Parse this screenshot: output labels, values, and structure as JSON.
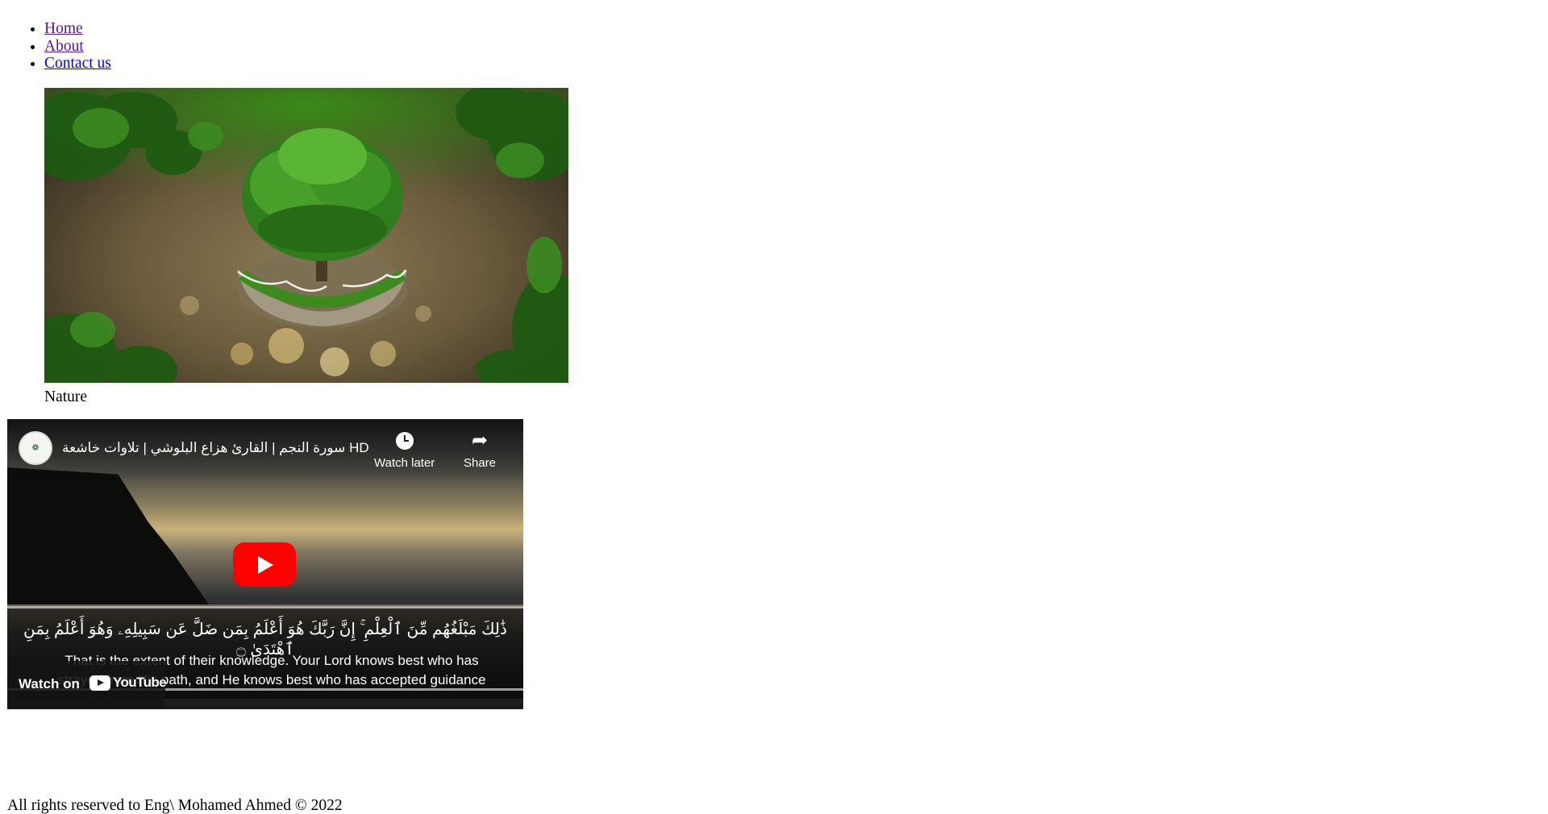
{
  "nav": {
    "items": [
      {
        "label": "Home",
        "visited": true
      },
      {
        "label": "About",
        "visited": true
      },
      {
        "label": "Contact us",
        "visited": false
      }
    ]
  },
  "figure": {
    "caption": "Nature"
  },
  "video": {
    "title": "سورة النجم | القارئ هزاع البلوشي | تلاوات خاشعة HD",
    "watch_later_label": "Watch later",
    "share_label": "Share",
    "arabic_subtitle": "ذَٰلِكَ مَبْلَغُهُم مِّنَ ٱلْعِلْمِ ۚ إِنَّ رَبَّكَ هُوَ أَعْلَمُ بِمَن ضَلَّ عَن سَبِيلِهِۦ وَهُوَ أَعْلَمُ بِمَنِ ٱهْتَدَىٰ ۝",
    "english_subtitle_line1": "That is the extent of their knowledge. Your Lord knows best who has",
    "english_subtitle_line2": "strayed from His path, and He knows best who has accepted guidance",
    "watch_on_label": "Watch on",
    "youtube_label": "YouTube",
    "accent_color": "#ff0000"
  },
  "footer": {
    "text": "All rights reserved to Eng\\ Mohamed Ahmed © 2022"
  }
}
